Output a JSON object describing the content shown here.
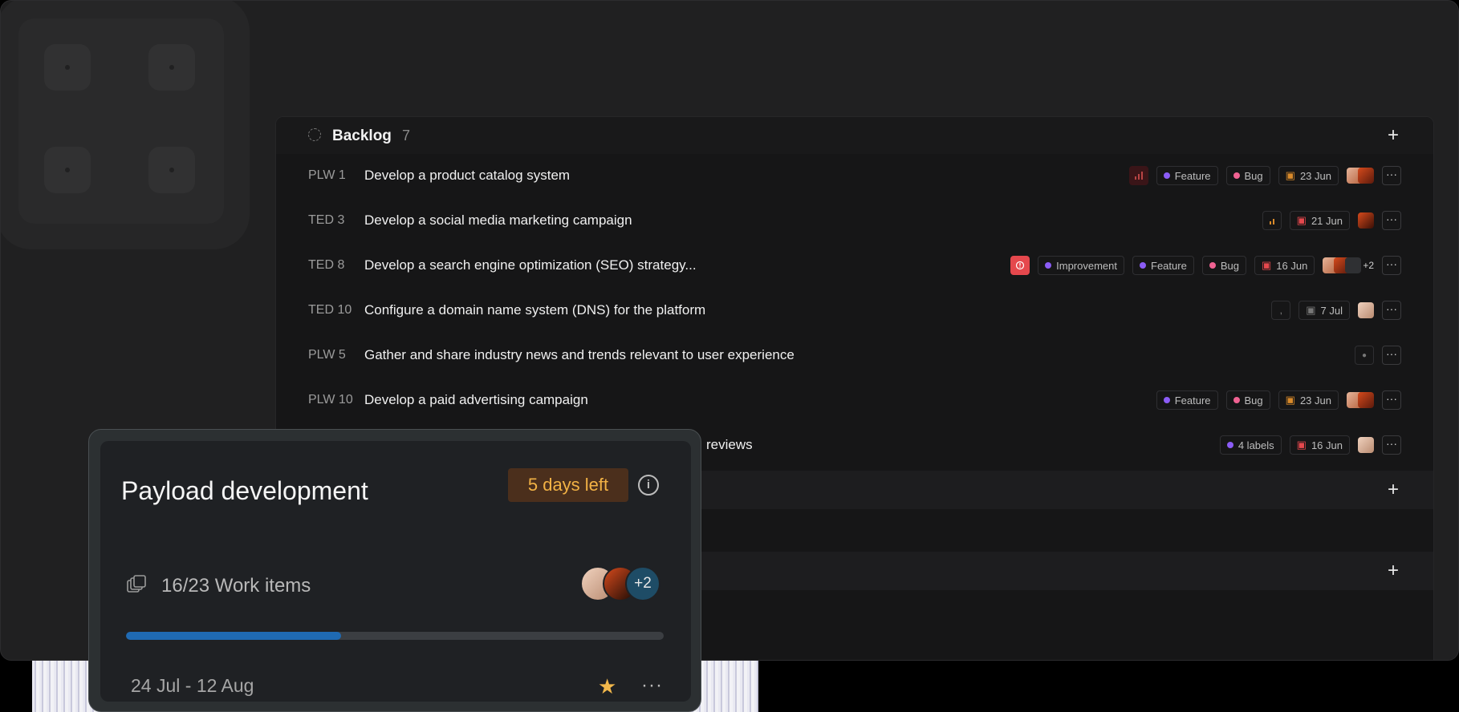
{
  "colors": {
    "window_bg": "#202021",
    "panel_bg": "#161617",
    "card_bg": "#1f2124",
    "accent_progress": "#1f6ab3",
    "days_left_text": "#f2b245",
    "label_feature": "#8b5cf6",
    "label_bug": "#f06292",
    "label_improvement": "#8b5cf6",
    "priority_urgent": "#e5484d",
    "priority_high": "#b84444",
    "priority_medium": "#d98a2b",
    "star": "#f2b84b"
  },
  "backlog": {
    "icon": "dashed-circle-icon",
    "title": "Backlog",
    "count": "7",
    "add_icon": "plus-icon",
    "rows": [
      {
        "id": "PLW 1",
        "title": "Develop a product catalog system",
        "priority": "high",
        "labels": [
          "Feature",
          "Bug"
        ],
        "date": "23 Jun",
        "extra_avatars": ""
      },
      {
        "id": "TED 3",
        "title": "Develop a social media marketing campaign",
        "priority": "medium",
        "labels": [],
        "date": "21 Jun",
        "extra_avatars": ""
      },
      {
        "id": "TED 8",
        "title": "Develop a search engine optimization (SEO) strategy...",
        "priority": "urgent",
        "labels": [
          "Improvement",
          "Feature",
          "Bug"
        ],
        "date": "16 Jun",
        "extra_avatars": "+2"
      },
      {
        "id": "TED 10",
        "title": "Configure a domain name system (DNS) for the platform",
        "priority": "none",
        "labels": [],
        "date": "7 Jul",
        "extra_avatars": ""
      },
      {
        "id": "PLW 5",
        "title": "Gather and share industry news and trends relevant to user experience",
        "priority": "",
        "labels": [],
        "date": "",
        "extra_avatars": ""
      },
      {
        "id": "PLW 10",
        "title": "Develop a paid advertising campaign",
        "priority": "",
        "labels": [
          "Feature",
          "Bug"
        ],
        "date": "23 Jun",
        "extra_avatars": ""
      },
      {
        "id": "",
        "title": "reviews",
        "priority": "",
        "labels": [
          "4 labels"
        ],
        "date": "16 Jun",
        "extra_avatars": ""
      }
    ]
  },
  "card": {
    "title": "Payload development",
    "days_left": "5 days left",
    "info_icon": "info-icon",
    "work_items_icon": "stacked-squares-icon",
    "work_items": "16/23 Work items",
    "progress": 0.4,
    "extra_members": "+2",
    "dates": "24 Jul - 12 Aug",
    "star_icon": "star-icon",
    "more_icon": "more-horizontal-icon"
  }
}
